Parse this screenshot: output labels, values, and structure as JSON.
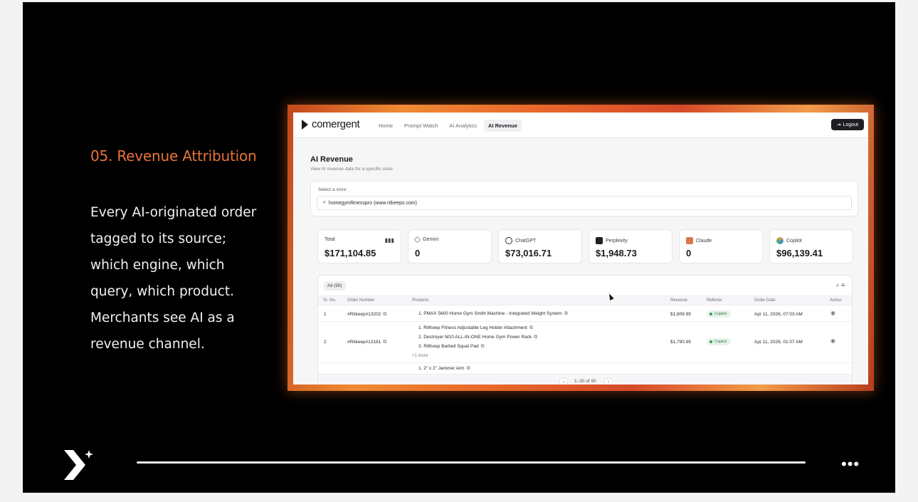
{
  "slide": {
    "heading": "05. Revenue Attribution",
    "body": "Every AI-originated order tagged to its source; which engine, which query, which product. Merchants see AI as a revenue channel.",
    "progress": 1.0
  },
  "app": {
    "brand": "comergent",
    "nav": [
      "Home",
      "Prompt Watch",
      "AI Analytics",
      "AI Revenue"
    ],
    "active_nav": "AI Revenue",
    "logout_label": "Logout",
    "title": "AI Revenue",
    "subtitle": "View AI revenue data for a specific store",
    "store_label": "Select a store",
    "store_value": "homegymfitnesspro (www.ritkeeps.com)",
    "metrics": [
      {
        "label": "Total",
        "value": "$171,104.85",
        "icon": "bar-chart-icon",
        "color": "#444444"
      },
      {
        "label": "Gemini",
        "value": "0",
        "icon": "gemini-icon",
        "color": "#7a7a82"
      },
      {
        "label": "ChatGPT",
        "value": "$73,016.71",
        "icon": "chatgpt-icon",
        "color": "#2a2a30"
      },
      {
        "label": "Perplexity",
        "value": "$1,948.73",
        "icon": "perplexity-icon",
        "color": "#1f1f23"
      },
      {
        "label": "Claude",
        "value": "0",
        "icon": "claude-icon",
        "color": "#d9774b"
      },
      {
        "label": "Copilot",
        "value": "$96,139.41",
        "icon": "copilot-icon",
        "color": "#e0a040"
      }
    ],
    "table": {
      "filter_label": "All (90)",
      "headers": [
        "Sr. No.",
        "Order Number",
        "Products",
        "Revenue",
        "Referrer",
        "Order Date",
        "Action"
      ],
      "rows": [
        {
          "sr": "1",
          "order": "#Ritkeep#13202",
          "products": [
            "1. PMAX 5600 Home Gym Smith Machine - Integrated Weight System"
          ],
          "more": "",
          "revenue": "$1,809.99",
          "referrer": "Copilot",
          "date": "Apr 11, 2026, 07:03 AM"
        },
        {
          "sr": "2",
          "order": "#Ritkeep#13181",
          "products": [
            "1. RitKeep Fitness Adjustable Leg Holder Attachment",
            "2. Destroyer M10 ALL-IN-ONE Home Gym Power Rack",
            "3. RitKeep Barbell Squat Pad"
          ],
          "more": "+1 more",
          "revenue": "$1,790.99",
          "referrer": "Copilot",
          "date": "Apr 11, 2026, 01:07 AM"
        },
        {
          "sr": "",
          "order": "",
          "products": [
            "1. 2\" x 2\" Jammer Arm"
          ],
          "more": "",
          "revenue": "",
          "referrer": "",
          "date": ""
        }
      ],
      "pagination": "1–30 of 90"
    }
  }
}
